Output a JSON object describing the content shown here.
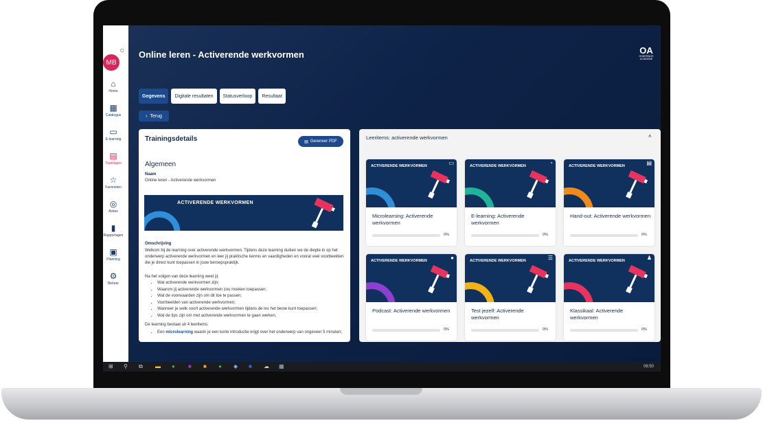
{
  "sidebar": {
    "avatar": "MB",
    "items": [
      {
        "label": "Home",
        "icon": "home-icon",
        "glyph": "⌂"
      },
      {
        "label": "Catalogus",
        "icon": "grid-icon",
        "glyph": "▦"
      },
      {
        "label": "E-learning",
        "icon": "monitor-icon",
        "glyph": "▭"
      },
      {
        "label": "Trainingen",
        "icon": "calendar-icon",
        "glyph": "▤"
      },
      {
        "label": "Favorieten",
        "icon": "star-icon",
        "glyph": "☆"
      },
      {
        "label": "Acties",
        "icon": "target-icon",
        "glyph": "◎"
      },
      {
        "label": "Rapportages",
        "icon": "bar-chart-icon",
        "glyph": "▮"
      },
      {
        "label": "Planning",
        "icon": "planning-icon",
        "glyph": "▣"
      },
      {
        "label": "Beheer",
        "icon": "gear-icon",
        "glyph": "⚙"
      }
    ]
  },
  "header": {
    "title": "Online leren - Activerende werkvormen",
    "logo_main": "OA",
    "logo_sub1": "ONDERWIJS",
    "logo_sub2": "ACADEMIE"
  },
  "tabs": [
    "Gegevens",
    "Digitale resultaten",
    "Statusverloop",
    "Resultaat"
  ],
  "back_label": "Terug",
  "details": {
    "title": "Trainingsdetails",
    "pdf_button": "Genereer PDF",
    "section": "Algemeen",
    "name_label": "Naam",
    "name_value": "Online leren - Activerende werkvormen",
    "banner_text": "ACTIVERENDE WERKVORMEN",
    "description_label": "Omschrijving",
    "description": "Welkom bij de learning over activerende werkvormen. Tijdens deze learning duiken we de diepte in op het onderwerp activerende werkvormen en leer jij praktische kennis en vaardigheden en vooral veel voorbeelden die je direct kunt toepassen in jouw beroepspraktijk.",
    "intro": "Na het volgen van deze learning weet jij:",
    "goals": [
      "Wat activerende werkvormen zijn;",
      "Waarom jij activerende werkvormen zou moeten toepassen;",
      "Wat de voorwaarden zijn om dit toe te passen;",
      "Voorbeelden van activerende werkvormen;",
      "Wanneer je welk soort activerende werkvormen tijdens de les het beste kunt toepassen;",
      "Wat de tips zijn om met activerende werkvormen te gaan werken."
    ],
    "consists": "De learning bestaat uit 4 leeritems:",
    "item_prefix": "Een",
    "item_bold": "microlearning",
    "item_rest": "waarin je een korte introductie krijgt over het onderwerp van ongeveer 5 minuten;"
  },
  "leeritems": {
    "title": "Leeritems: activerende werkvormen",
    "header_text": "ACTIVERENDE WERKVORMEN",
    "items": [
      {
        "name": "Microlearning: Activerende werkvormen",
        "progress": "0%",
        "color": "#2f8fd8",
        "icon": "laptop-icon",
        "glyph": "▭"
      },
      {
        "name": "E-learning: Activerende werkvormen",
        "progress": "0%",
        "color": "#1fb39a",
        "icon": "clock-icon",
        "glyph": "◔"
      },
      {
        "name": "Hand-out: Activerende werkvormen",
        "progress": "0%",
        "color": "#f08a1c",
        "icon": "document-icon",
        "glyph": "▤"
      },
      {
        "name": "Podcast: Activerende werkvormen",
        "progress": "0%",
        "color": "#8d3fd0",
        "icon": "microphone-icon",
        "glyph": "●"
      },
      {
        "name": "Test jezelf: Activerende werkvormen",
        "progress": "0%",
        "color": "#f2b316",
        "icon": "checklist-icon",
        "glyph": "☰"
      },
      {
        "name": "Klassikaal: Activerende werkvormen",
        "progress": "0%",
        "color": "#e8335e",
        "icon": "classroom-icon",
        "glyph": "♟"
      }
    ]
  },
  "taskbar": {
    "time": "08:50"
  },
  "colors": {
    "primary": "#1d4a8c",
    "accent": "#d6285a",
    "banner": "#10305e"
  }
}
